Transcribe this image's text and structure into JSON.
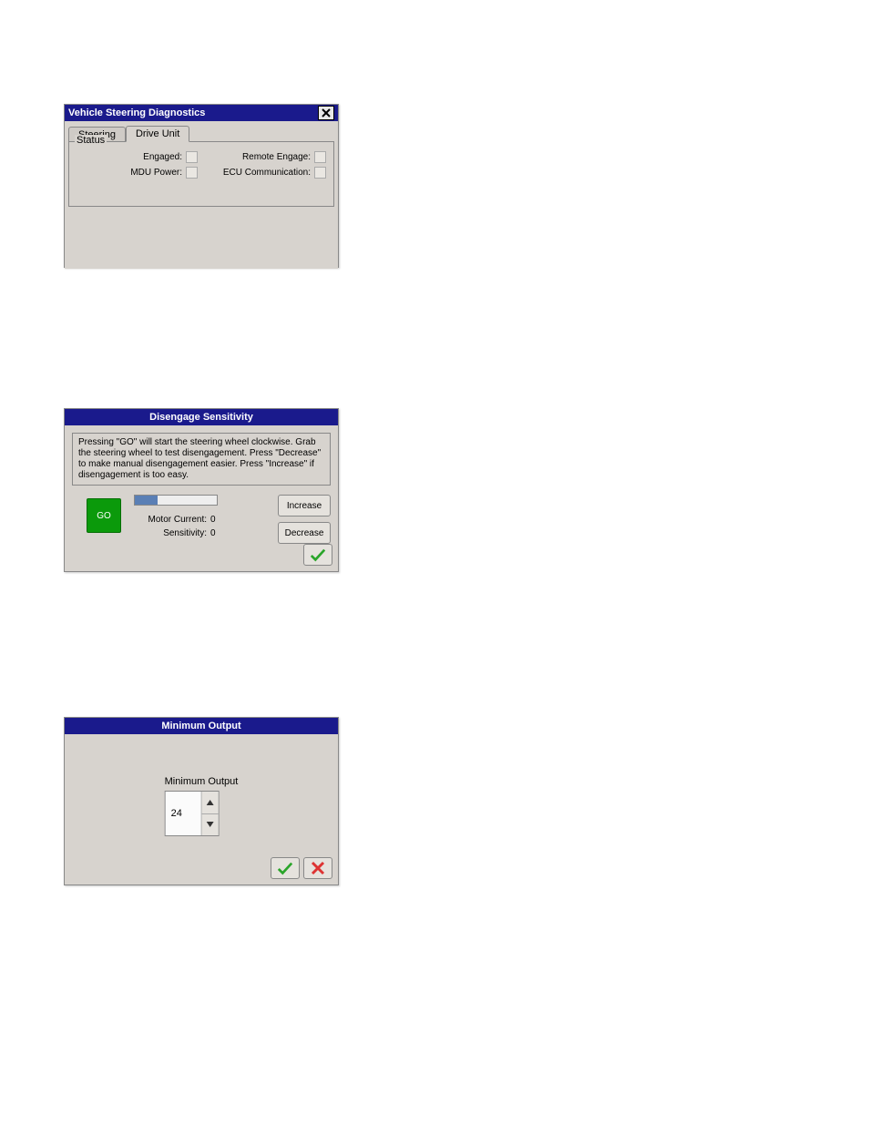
{
  "win_diag": {
    "title": "Vehicle Steering Diagnostics",
    "tabs": {
      "steering": "Steering",
      "drive_unit": "Drive Unit",
      "active": "drive_unit"
    },
    "group_label": "Status",
    "status": {
      "engaged_label": "Engaged:",
      "mdu_label": "MDU Power:",
      "remote_label": "Remote Engage:",
      "ecu_label": "ECU Communication:"
    }
  },
  "win_disengage": {
    "title": "Disengage Sensitivity",
    "instructions": "Pressing \"GO\" will start the steering wheel clockwise. Grab the steering wheel to test disengagement. Press \"Decrease\" to make manual disengagement easier. Press \"Increase\" if disengagement is too easy.",
    "go_label": "GO",
    "motor_current_label": "Motor Current:",
    "motor_current_value": "0",
    "sensitivity_label": "Sensitivity:",
    "sensitivity_value": "0",
    "increase_label": "Increase",
    "decrease_label": "Decrease",
    "progress_pct": 28
  },
  "win_min": {
    "title": "Minimum Output",
    "field_label": "Minimum Output",
    "value": "24"
  }
}
